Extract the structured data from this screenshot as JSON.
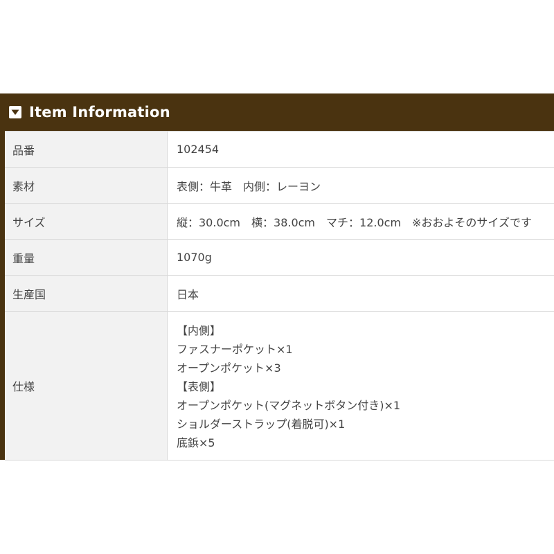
{
  "header": {
    "title": "Item Information",
    "icon": "caret-down-icon",
    "colors": {
      "header_bg": "#4a3310",
      "label_bg": "#f2f2f2",
      "text": "#444444"
    }
  },
  "rows": [
    {
      "label": "品番",
      "value": "102454"
    },
    {
      "label": "素材",
      "value": "表側：牛革　内側：レーヨン"
    },
    {
      "label": "サイズ",
      "value": "縦：30.0cm　横：38.0cm　マチ：12.0cm　※おおよそのサイズです"
    },
    {
      "label": "重量",
      "value": "1070g"
    },
    {
      "label": "生産国",
      "value": "日本"
    }
  ],
  "spec": {
    "label": "仕様",
    "lines": [
      "【内側】",
      "ファスナーポケット×1",
      "オープンポケット×3",
      "【表側】",
      "オープンポケット(マグネットボタン付き)×1",
      "ショルダーストラップ(着脱可)×1",
      "底鋲×5"
    ]
  }
}
